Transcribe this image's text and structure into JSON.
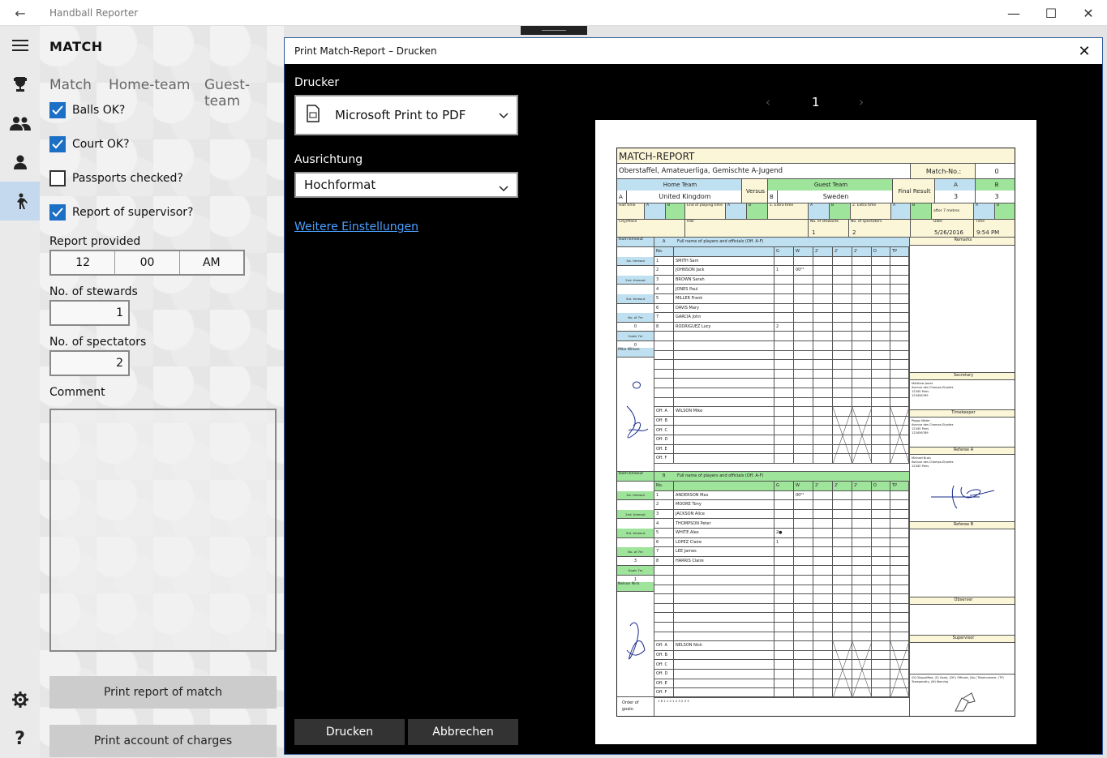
{
  "app": {
    "title": "Handball Reporter"
  },
  "window_controls": {
    "minimize": "—",
    "maximize": "☐",
    "close": "✕"
  },
  "main": {
    "header": "MATCH",
    "tabs": [
      "Match",
      "Home-team",
      "Guest-team"
    ],
    "checkboxes": [
      {
        "label": "Balls OK?",
        "checked": true
      },
      {
        "label": "Court OK?",
        "checked": true
      },
      {
        "label": "Passports checked?",
        "checked": false
      },
      {
        "label": "Report of supervisor?",
        "checked": true
      }
    ],
    "report_provided": {
      "label": "Report provided",
      "hour": "12",
      "minute": "00",
      "ampm": "AM"
    },
    "stewards": {
      "label": "No. of stewards",
      "value": "1"
    },
    "spectators": {
      "label": "No. of spectators",
      "value": "2"
    },
    "comment": {
      "label": "Comment",
      "value": ""
    },
    "buttons": {
      "print_report": "Print report of match",
      "print_charges": "Print account of charges"
    }
  },
  "dialog": {
    "title": "Print Match-Report – Drucken",
    "printer_label": "Drucker",
    "printer_value": "Microsoft Print to PDF",
    "orientation_label": "Ausrichtung",
    "orientation_value": "Hochformat",
    "more_settings": "Weitere Einstellungen",
    "print_button": "Drucken",
    "cancel_button": "Abbrechen",
    "page": "1"
  },
  "report": {
    "title": "MATCH-REPORT",
    "league": "Oberstaffel, Amateuerliga, Gemischte A-Jugend",
    "match_no_label": "Match-No.:",
    "match_no": "0",
    "home_team_label": "Home Team",
    "versus": "Versus",
    "guest_team_label": "Guest Team",
    "final_result_label": "Final Result",
    "home_team": "United Kingdom",
    "guest_team": "Sweden",
    "side_a": "A",
    "side_b": "B",
    "score_a": "3",
    "score_b": "3",
    "half_time_label": "Half time",
    "end_label": "End of playing time",
    "extra1_label": "1. Extra time",
    "extra2_label": "2. Extra time",
    "after7_label": "after 7 metres",
    "city_label": "City/Place",
    "hall_label": "Hall",
    "stewards_label": "No. of stewards",
    "spectators_label": "No. of spectators",
    "date_label": "Date",
    "time_label": "Time",
    "stewards_value": "1",
    "spectators_value": "2",
    "date": "5/26/2016",
    "time": "9:54 PM",
    "team_timeout": "Team-timeout",
    "fullname_a": "Full name of players and officials (Off. A-F)",
    "fullname_b": "Full name of players and officials (Off. A-F)",
    "no_label": "No.",
    "cols": [
      "G",
      "W",
      "2'",
      "2'",
      "2'",
      "D",
      "TP"
    ],
    "remarks": "Remarks",
    "players_a": [
      {
        "no": "1",
        "name": "SMITH Sam",
        "g": "",
        "w": ""
      },
      {
        "no": "2",
        "name": "JOHNSON Jack",
        "g": "1",
        "w": "00⁰¹"
      },
      {
        "no": "3",
        "name": "BROWN Sarah",
        "g": "",
        "w": ""
      },
      {
        "no": "4",
        "name": "JONES Paul",
        "g": "",
        "w": ""
      },
      {
        "no": "5",
        "name": "MILLER Frank",
        "g": "",
        "w": ""
      },
      {
        "no": "6",
        "name": "DAVIS Mary",
        "g": "",
        "w": ""
      },
      {
        "no": "7",
        "name": "GARCIA John",
        "g": "",
        "w": ""
      },
      {
        "no": "8",
        "name": "RODRIGUEZ Lucy",
        "g": "2",
        "w": ""
      }
    ],
    "players_b": [
      {
        "no": "1",
        "name": "ANDERSON Max",
        "g": "",
        "w": "00⁰¹"
      },
      {
        "no": "2",
        "name": "MOORE Tony",
        "g": "",
        "w": ""
      },
      {
        "no": "3",
        "name": "JACKSON Alice",
        "g": "",
        "w": ""
      },
      {
        "no": "4",
        "name": "THOMPSON Peter",
        "g": "",
        "w": ""
      },
      {
        "no": "5",
        "name": "WHITE Alex",
        "g": "2●",
        "w": ""
      },
      {
        "no": "6",
        "name": "LOPEZ Claire",
        "g": "1",
        "w": ""
      },
      {
        "no": "7",
        "name": "LEE James",
        "g": "",
        "w": ""
      },
      {
        "no": "8",
        "name": "HARRIS Claire",
        "g": "",
        "w": ""
      }
    ],
    "timeouts": [
      "1st. timeout",
      "2nd. timeout",
      "3rd. timeout",
      "No. of 7m",
      "Goals 7m"
    ],
    "a_7m": "0",
    "a_goals7m": "0",
    "b_7m": "3",
    "b_goals7m": "1",
    "official_a_label": "Mike Wilson",
    "official_b_label": "Nelson Nick",
    "off_a_name": "WILSON Mike",
    "off_b_name": "NELSON Nick",
    "offs": [
      "Off. A",
      "Off. B",
      "Off. C",
      "Off. D",
      "Off. E",
      "Off. F"
    ],
    "secretary_label": "Secretary",
    "secretary_text": "Matthew Jones\nAvenue des Champs-Elysées\n12345 Paris\n123456789",
    "timekeeper_label": "Timekeeper",
    "timekeeper_text": "Peggy Water\nAvenue des Champs-Elysées\n12345 Paris\n123456789",
    "refa_label": "Referee A",
    "refa_text": "Michael Bush\nAvenue des Champs-Elysées\n12345 Paris",
    "refb_label": "Referee B",
    "observer_label": "Observer",
    "supervisor_label": "Supervisor",
    "order_label": "Order of goals:",
    "order_value": "1 8 1 1 2 1 2 3 2 3 3",
    "legend": "(D) Disqualified, (G) Goals, (Off.) Officials, (No.) Trikotnummer, (TP) Teampenalty, (W) Warning"
  },
  "colors": {
    "accent": "#1b6fc5",
    "sheet_yellow": "#fbf6d8",
    "sheet_blue": "#bfe0f0",
    "sheet_green": "#9ee49a"
  }
}
